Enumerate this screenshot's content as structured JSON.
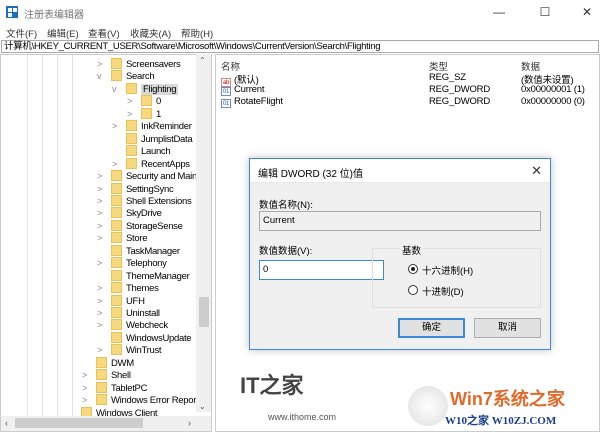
{
  "window": {
    "title": "注册表编辑器",
    "buttons": {
      "minimize": "—",
      "maximize": "☐",
      "close": "✕"
    }
  },
  "menu": [
    "文件(F)",
    "编辑(E)",
    "查看(V)",
    "收藏夹(A)",
    "帮助(H)"
  ],
  "address": "计算机\\HKEY_CURRENT_USER\\Software\\Microsoft\\Windows\\CurrentVersion\\Search\\Flighting",
  "tree": [
    {
      "label": "Screensavers",
      "level": 3,
      "chevron": ">"
    },
    {
      "label": "Search",
      "level": 3,
      "chevron": "v"
    },
    {
      "label": "Flighting",
      "level": 4,
      "chevron": "v",
      "selected": true
    },
    {
      "label": "0",
      "level": 5,
      "chevron": ">"
    },
    {
      "label": "1",
      "level": 5,
      "chevron": ">"
    },
    {
      "label": "InkReminder",
      "level": 4,
      "chevron": ">"
    },
    {
      "label": "JumplistData",
      "level": 4,
      "chevron": ""
    },
    {
      "label": "Launch",
      "level": 4,
      "chevron": ""
    },
    {
      "label": "RecentApps",
      "level": 4,
      "chevron": ">"
    },
    {
      "label": "Security and Mainte",
      "level": 3,
      "chevron": ">"
    },
    {
      "label": "SettingSync",
      "level": 3,
      "chevron": ">"
    },
    {
      "label": "Shell Extensions",
      "level": 3,
      "chevron": ">"
    },
    {
      "label": "SkyDrive",
      "level": 3,
      "chevron": ">"
    },
    {
      "label": "StorageSense",
      "level": 3,
      "chevron": ">"
    },
    {
      "label": "Store",
      "level": 3,
      "chevron": ">"
    },
    {
      "label": "TaskManager",
      "level": 3,
      "chevron": ""
    },
    {
      "label": "Telephony",
      "level": 3,
      "chevron": ">"
    },
    {
      "label": "ThemeManager",
      "level": 3,
      "chevron": ""
    },
    {
      "label": "Themes",
      "level": 3,
      "chevron": ">"
    },
    {
      "label": "UFH",
      "level": 3,
      "chevron": ">"
    },
    {
      "label": "Uninstall",
      "level": 3,
      "chevron": ">"
    },
    {
      "label": "Webcheck",
      "level": 3,
      "chevron": ">"
    },
    {
      "label": "WindowsUpdate",
      "level": 3,
      "chevron": ""
    },
    {
      "label": "WinTrust",
      "level": 3,
      "chevron": ">"
    },
    {
      "label": "DWM",
      "level": 2,
      "chevron": ""
    },
    {
      "label": "Shell",
      "level": 2,
      "chevron": ">"
    },
    {
      "label": "TabletPC",
      "level": 2,
      "chevron": ">"
    },
    {
      "label": "Windows Error Reportin",
      "level": 2,
      "chevron": ">"
    },
    {
      "label": "Windows Client",
      "level": 1,
      "chevron": ""
    }
  ],
  "list": {
    "headers": {
      "name": "名称",
      "type": "类型",
      "data": "数据"
    },
    "rows": [
      {
        "icon": "ab",
        "name": "(默认)",
        "type": "REG_SZ",
        "data": "(数值未设置)"
      },
      {
        "icon": "bin",
        "name": "Current",
        "type": "REG_DWORD",
        "data": "0x00000001 (1)"
      },
      {
        "icon": "bin",
        "name": "RotateFlight",
        "type": "REG_DWORD",
        "data": "0x00000000 (0)"
      }
    ]
  },
  "dialog": {
    "title": "编辑 DWORD (32 位)值",
    "close": "✕",
    "name_label": "数值名称(N):",
    "name_value": "Current",
    "data_label": "数值数据(V):",
    "data_value": "0",
    "base_label": "基数",
    "hex_label": "十六进制(H)",
    "dec_label": "十进制(D)",
    "base_selected": "hex",
    "ok": "确定",
    "cancel": "取消"
  },
  "watermarks": {
    "ithome_logo": "IT之家",
    "ithome_url": "www.ithome.com",
    "win7": "Win7系统之家",
    "w10": "W10之家 W10ZJ.COM"
  }
}
